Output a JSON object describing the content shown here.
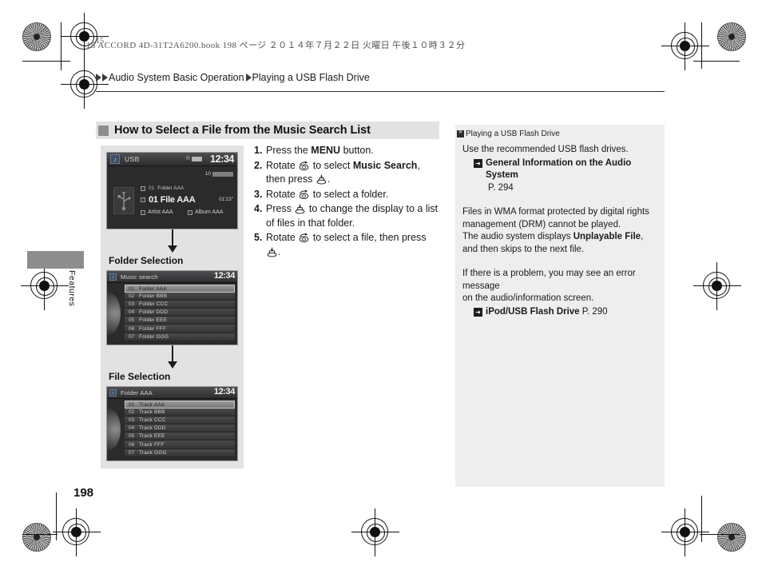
{
  "print": {
    "slugline": "15 ACCORD 4D-31T2A6200.book   198 ページ   ２０１４年７月２２日   火曜日   午後１０時３２分",
    "corner_code": "15"
  },
  "breadcrumb": {
    "part1": "Audio System Basic Operation",
    "part2": "Playing a USB Flash Drive"
  },
  "side_tab": {
    "label": "Features"
  },
  "page_number": "198",
  "section": {
    "heading": "How to Select a File from the Music Search List"
  },
  "steps": [
    {
      "num": "1.",
      "pre": "Press the ",
      "bold": "MENU",
      "post": " button.",
      "icon": ""
    },
    {
      "num": "2.",
      "pre": "Rotate ",
      "icon": "rotate-knob-icon",
      "mid": " to select ",
      "bold": "Music Search",
      "post": ", then press ",
      "icon2": "press-knob-icon",
      "tail": "."
    },
    {
      "num": "3.",
      "pre": "Rotate ",
      "icon": "rotate-knob-icon",
      "post": " to select a folder."
    },
    {
      "num": "4.",
      "pre": "Press ",
      "icon": "press-knob-icon",
      "post": " to change the display to a list of files in that folder."
    },
    {
      "num": "5.",
      "pre": "Rotate ",
      "icon": "rotate-knob-icon",
      "mid": " to select a file, then press ",
      "icon2": "press-knob-icon",
      "tail": "."
    }
  ],
  "screens": {
    "now_playing": {
      "source": "USB",
      "clock": "12:34",
      "indicator": "R",
      "volume_label": "10",
      "track_time": "01'23\"",
      "row_folder_num": "01",
      "row_folder": "Folder AAA",
      "row_file": "01 File AAA",
      "row_artist": "Artist AAA",
      "row_album": "Album AAA"
    },
    "folder_selection": {
      "caption": "Folder Selection",
      "title": "Music search",
      "clock": "12:34",
      "rows": [
        {
          "num": "01",
          "label": "Folder AAA",
          "selected": true
        },
        {
          "num": "02",
          "label": "Folder BBB",
          "selected": false
        },
        {
          "num": "03",
          "label": "Folder CCC",
          "selected": false
        },
        {
          "num": "04",
          "label": "Folder DDD",
          "selected": false
        },
        {
          "num": "05",
          "label": "Folder EEE",
          "selected": false
        },
        {
          "num": "06",
          "label": "Folder FFF",
          "selected": false
        },
        {
          "num": "07",
          "label": "Folder GGG",
          "selected": false
        }
      ]
    },
    "file_selection": {
      "caption": "File Selection",
      "title": "Folder AAA",
      "clock": "12:34",
      "rows": [
        {
          "num": "01",
          "label": "Track AAA",
          "selected": true
        },
        {
          "num": "02",
          "label": "Track BBB",
          "selected": false
        },
        {
          "num": "03",
          "label": "Track CCC",
          "selected": false
        },
        {
          "num": "04",
          "label": "Track DDD",
          "selected": false
        },
        {
          "num": "05",
          "label": "Track EEE",
          "selected": false
        },
        {
          "num": "06",
          "label": "Track FFF",
          "selected": false
        },
        {
          "num": "07",
          "label": "Track GGG",
          "selected": false
        }
      ]
    }
  },
  "sidebar": {
    "header": "Playing a USB Flash Drive",
    "para1": "Use the recommended USB flash drives.",
    "ref1_title": "General Information on the Audio System",
    "ref1_page": "P. 294",
    "para2_line1": "Files in WMA format protected by digital rights",
    "para2_line2": "management (DRM) cannot be played.",
    "para3_pre": "The audio system displays ",
    "para3_bold": "Unplayable File",
    "para3_post": ", and then skips to the next file.",
    "para4_line1": "If there is a problem, you may see an error message",
    "para4_line2": "on the audio/information screen.",
    "ref2_title": "iPod/USB Flash Drive",
    "ref2_page": "P. 290"
  },
  "colors": {
    "heading_band": "#e2e2e2",
    "sidebar_bg": "#eeeeee",
    "tab_gray": "#8d8d8d",
    "screen_dark": "#2b2b2b"
  }
}
